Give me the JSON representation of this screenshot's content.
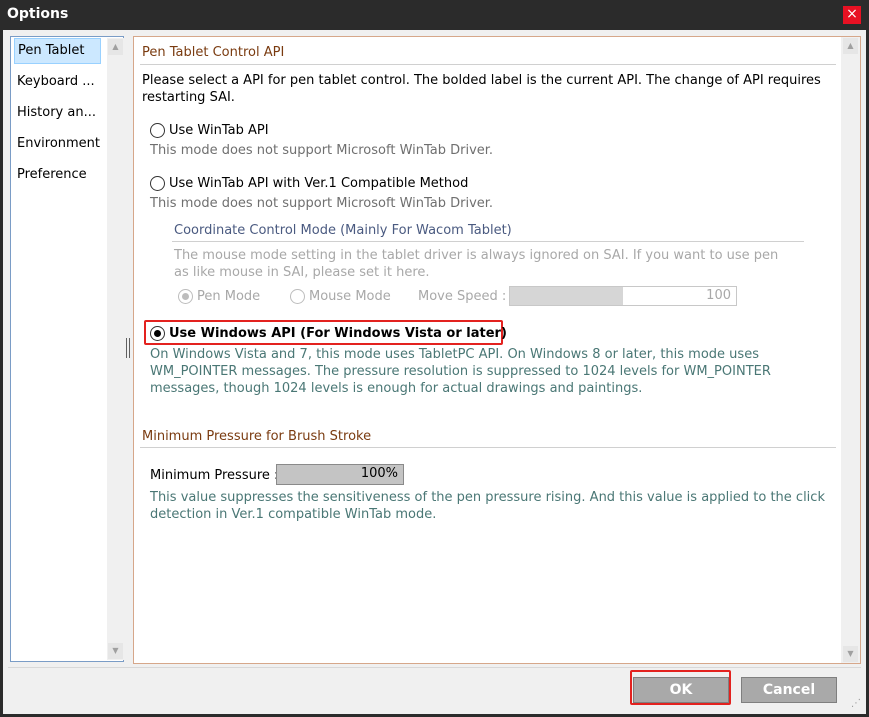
{
  "window": {
    "title": "Options",
    "close_glyph": "×"
  },
  "sidebar": {
    "items": [
      {
        "label": "Pen Tablet",
        "selected": true
      },
      {
        "label": "Keyboard ..."
      },
      {
        "label": "History an..."
      },
      {
        "label": "Environment"
      },
      {
        "label": "Preference"
      }
    ]
  },
  "pen_tablet": {
    "header": "Pen Tablet Control API",
    "intro": "Please select a API for pen tablet control. The bolded label is the current API. The change of API requires restarting SAI.",
    "options": [
      {
        "label": "Use WinTab API",
        "note": "This mode does not support Microsoft WinTab Driver.",
        "checked": false
      },
      {
        "label": "Use WinTab API with Ver.1 Compatible Method",
        "note": "This mode does not support Microsoft WinTab Driver.",
        "checked": false
      },
      {
        "label": "Use Windows API (For Windows Vista or later)",
        "note": "On Windows Vista and 7, this mode uses TabletPC API. On Windows 8 or later, this mode uses WM_POINTER messages. The pressure resolution is suppressed to 1024 levels for WM_POINTER messages, though 1024 levels is enough for actual drawings and paintings.",
        "checked": true
      }
    ],
    "coord": {
      "header": "Coordinate Control Mode (Mainly For Wacom Tablet)",
      "note": "The mouse mode setting in the tablet driver is always ignored on SAI. If you want to use pen as like mouse in SAI, please set it here.",
      "pen_mode": "Pen Mode",
      "mouse_mode": "Mouse Mode",
      "move_speed_label": "Move Speed :",
      "move_speed_value": "100",
      "move_speed_fraction": 0.5
    }
  },
  "pressure": {
    "header": "Minimum Pressure for Brush Stroke",
    "label": "Minimum Pressure :",
    "value": "100%",
    "fraction": 1.0,
    "note": "This value suppresses the sensitiveness of the pen pressure rising. And this value is applied to the click detection in Ver.1 compatible WinTab mode."
  },
  "buttons": {
    "ok": "OK",
    "cancel": "Cancel"
  },
  "colors": {
    "highlight": "#e3221f",
    "section_header": "#7a3b10",
    "note_teal": "#4a7775"
  }
}
